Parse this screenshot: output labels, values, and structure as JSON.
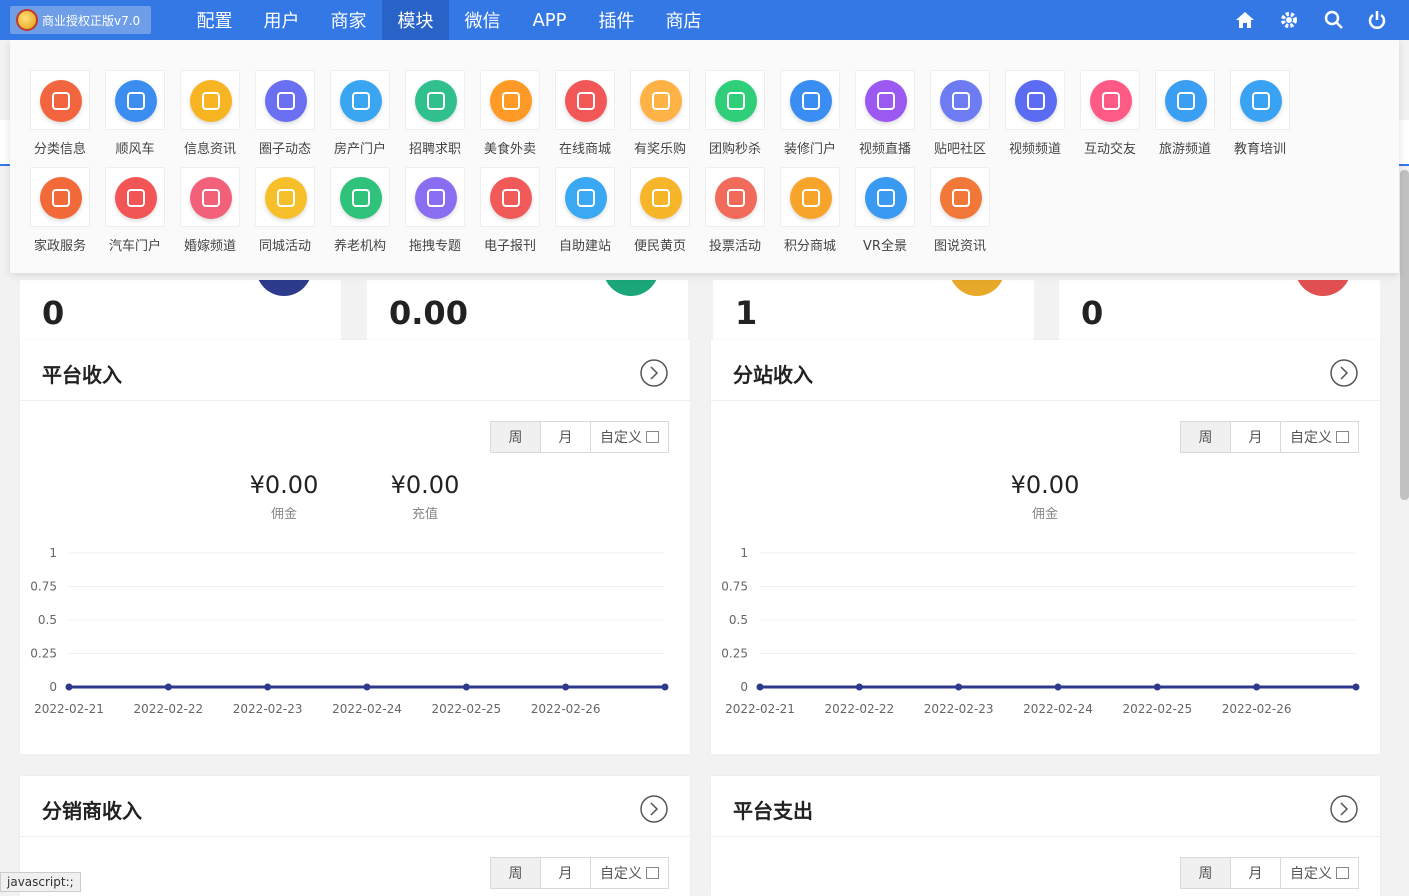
{
  "topbar": {
    "logo_text": "商业授权正版v7.0",
    "nav": [
      "配置",
      "用户",
      "商家",
      "模块",
      "微信",
      "APP",
      "插件",
      "商店"
    ],
    "active_nav": "模块",
    "icons": [
      "home-icon",
      "gear-icon",
      "search-icon",
      "power-icon"
    ]
  },
  "modules": [
    {
      "label": "分类信息",
      "color": "#f2653f"
    },
    {
      "label": "顺风车",
      "color": "#3b8ef0"
    },
    {
      "label": "信息资讯",
      "color": "#f7b524"
    },
    {
      "label": "圈子动态",
      "color": "#6b6ff2"
    },
    {
      "label": "房产门户",
      "color": "#3aa6f2"
    },
    {
      "label": "招聘求职",
      "color": "#2fc08e"
    },
    {
      "label": "美食外卖",
      "color": "#ff9a26"
    },
    {
      "label": "在线商城",
      "color": "#f25757"
    },
    {
      "label": "有奖乐购",
      "color": "#ffb347"
    },
    {
      "label": "团购秒杀",
      "color": "#2fcf7a"
    },
    {
      "label": "装修门户",
      "color": "#3a8df2"
    },
    {
      "label": "视频直播",
      "color": "#9b59f2"
    },
    {
      "label": "贴吧社区",
      "color": "#6d7cf2"
    },
    {
      "label": "视频频道",
      "color": "#5b6cf2"
    },
    {
      "label": "互动交友",
      "color": "#ff5a86"
    },
    {
      "label": "旅游频道",
      "color": "#3a9ef2"
    },
    {
      "label": "教育培训",
      "color": "#3aa2f2"
    },
    {
      "label": "家政服务",
      "color": "#f26a3a"
    },
    {
      "label": "汽车门户",
      "color": "#f25555"
    },
    {
      "label": "婚嫁频道",
      "color": "#f2607a"
    },
    {
      "label": "同城活动",
      "color": "#f7c02a"
    },
    {
      "label": "养老机构",
      "color": "#2fc27a"
    },
    {
      "label": "拖拽专题",
      "color": "#8a6ef2"
    },
    {
      "label": "电子报刊",
      "color": "#f25a5a"
    },
    {
      "label": "自助建站",
      "color": "#3aa8f2"
    },
    {
      "label": "便民黄页",
      "color": "#f7b52a"
    },
    {
      "label": "投票活动",
      "color": "#f26a5a"
    },
    {
      "label": "积分商城",
      "color": "#f7a52a"
    },
    {
      "label": "VR全景",
      "color": "#3a9af2"
    },
    {
      "label": "图说资讯",
      "color": "#f2783a"
    }
  ],
  "stats": [
    {
      "value": "0",
      "color": "#2d3a8c"
    },
    {
      "value": "0.00",
      "color": "#1aa67a"
    },
    {
      "value": "1",
      "color": "#e8a92a"
    },
    {
      "value": "0",
      "color": "#e05050"
    }
  ],
  "panels": [
    {
      "title": "平台收入",
      "seg": [
        "周",
        "月",
        "自定义"
      ],
      "amounts": [
        {
          "value": "¥0.00",
          "label": "佣金"
        },
        {
          "value": "¥0.00",
          "label": "充值"
        }
      ]
    },
    {
      "title": "分站收入",
      "seg": [
        "周",
        "月",
        "自定义"
      ],
      "amounts": [
        {
          "value": "¥0.00",
          "label": "佣金"
        }
      ]
    },
    {
      "title": "分销商收入",
      "seg": [
        "周",
        "月",
        "自定义"
      ]
    },
    {
      "title": "平台支出",
      "seg": [
        "周",
        "月",
        "自定义"
      ]
    }
  ],
  "chart_data": [
    {
      "type": "line",
      "x": [
        "2022-02-21",
        "2022-02-22",
        "2022-02-23",
        "2022-02-24",
        "2022-02-25",
        "2022-02-26",
        ""
      ],
      "yticks": [
        "1",
        "0.75",
        "0.5",
        "0.25",
        "0"
      ],
      "series": [
        {
          "values": [
            0,
            0,
            0,
            0,
            0,
            0,
            0
          ]
        }
      ],
      "ylim": [
        0,
        1
      ],
      "color": "#2d3a8c"
    },
    {
      "type": "line",
      "x": [
        "2022-02-21",
        "2022-02-22",
        "2022-02-23",
        "2022-02-24",
        "2022-02-25",
        "2022-02-26",
        ""
      ],
      "yticks": [
        "1",
        "0.75",
        "0.5",
        "0.25",
        "0"
      ],
      "series": [
        {
          "values": [
            0,
            0,
            0,
            0,
            0,
            0,
            0
          ]
        }
      ],
      "ylim": [
        0,
        1
      ],
      "color": "#2d3a8c"
    }
  ],
  "statusbar": "javascript:;"
}
